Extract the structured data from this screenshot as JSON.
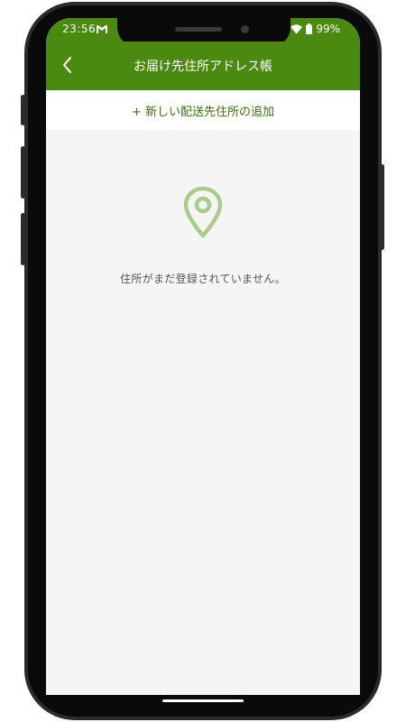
{
  "status_bar": {
    "time": "23:56",
    "battery": "99%",
    "icons": [
      "gmail-icon",
      "wifi-icon",
      "battery-icon"
    ]
  },
  "app_bar": {
    "title": "お届け先住所アドレス帳",
    "back_icon": "chevron-left-icon"
  },
  "add_address": {
    "label": "+ 新しい配送先住所の追加"
  },
  "empty_state": {
    "icon": "location-pin-icon",
    "message": "住所がまだ登録されていません。"
  },
  "colors": {
    "primary": "#4a8a10",
    "primary_text": "#3b6e10",
    "pin_icon": "#a9cc8a",
    "background": "#f5f5f5"
  }
}
